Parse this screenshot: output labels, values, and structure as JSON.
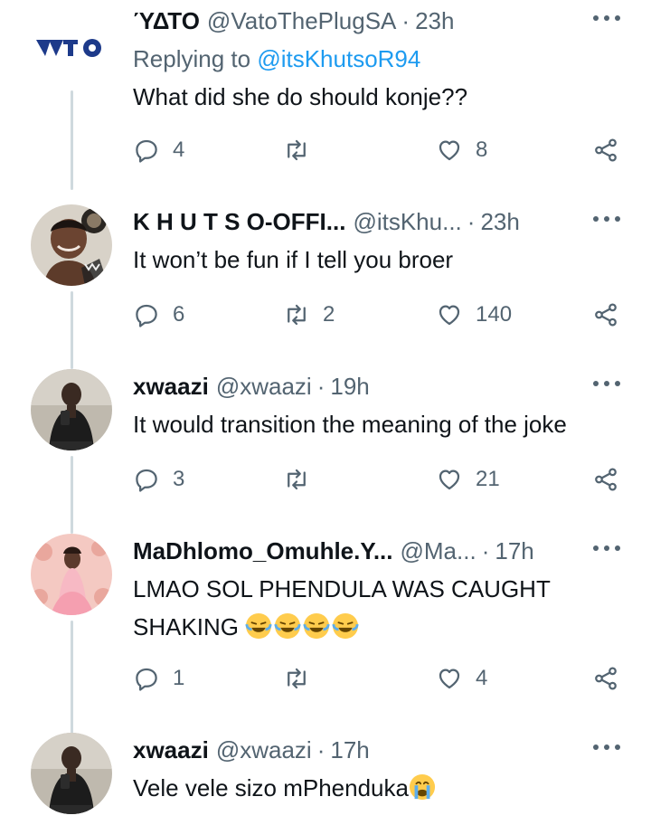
{
  "tweets": [
    {
      "name": "ΎΔΤΟ",
      "handle": "@VatoThePlugSA",
      "time": "23h",
      "replying_prefix": "Replying to",
      "replying_to": "@itsKhutsoR94",
      "text": "What did she do should konje??",
      "replies": "4",
      "retweets": "",
      "likes": "8"
    },
    {
      "name": "K H U T S O-OFFI...",
      "handle": "@itsKhu...",
      "time": "23h",
      "text": "It won’t be fun if I tell you broer",
      "replies": "6",
      "retweets": "2",
      "likes": "140"
    },
    {
      "name": "xwaazi",
      "handle": "@xwaazi",
      "time": "19h",
      "text": "It would transition the meaning of the joke",
      "replies": "3",
      "retweets": "",
      "likes": "21"
    },
    {
      "name": "MaDhlomo_Omuhle.Y...",
      "handle": "@Ma...",
      "time": "17h",
      "text_line1": "LMAO SOL PHENDULA WAS CAUGHT",
      "text_line2": "SHAKING",
      "replies": "1",
      "retweets": "",
      "likes": "4"
    },
    {
      "name": "xwaazi",
      "handle": "@xwaazi",
      "time": "17h",
      "text": "Vele vele sizo mPhenduka"
    }
  ],
  "icons": {
    "reply": "reply-icon",
    "retweet": "retweet-icon",
    "like": "like-icon",
    "share": "share-icon",
    "more": "more-options-icon"
  },
  "colors": {
    "text": "#0f1419",
    "secondary": "#536471",
    "link": "#1d9bf0",
    "thread": "#cfd9de"
  }
}
